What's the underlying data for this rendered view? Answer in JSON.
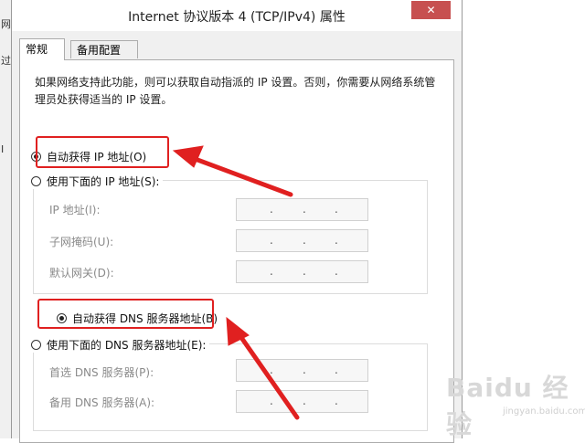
{
  "background_window": {
    "fragments": [
      "网",
      "过",
      "I"
    ]
  },
  "window": {
    "title": "Internet 协议版本 4 (TCP/IPv4) 属性",
    "close_glyph": "✕"
  },
  "tabs": [
    {
      "label": "常规",
      "active": true
    },
    {
      "label": "备用配置",
      "active": false
    }
  ],
  "general": {
    "description": "如果网络支持此功能，则可以获取自动指派的 IP 设置。否则，你需要从网络系统管理员处获得适当的 IP 设置。",
    "ip_mode": {
      "auto_label": "自动获得 IP 地址(O)",
      "manual_label": "使用下面的 IP 地址(S):",
      "selected": "auto"
    },
    "ip_fields": [
      {
        "label": "IP 地址(I):",
        "value": ""
      },
      {
        "label": "子网掩码(U):",
        "value": ""
      },
      {
        "label": "默认网关(D):",
        "value": ""
      }
    ],
    "dns_mode": {
      "auto_label": "自动获得 DNS 服务器地址(B)",
      "manual_label": "使用下面的 DNS 服务器地址(E):",
      "selected": "auto"
    },
    "dns_fields": [
      {
        "label": "首选 DNS 服务器(P):",
        "value": ""
      },
      {
        "label": "备用 DNS 服务器(A):",
        "value": ""
      }
    ]
  },
  "annotations": {
    "highlight_color": "#e02020",
    "arrow_color": "#e02020"
  },
  "watermark": {
    "logo_text": "Baidu 经验",
    "url": "jingyan.baidu.com"
  },
  "colors": {
    "close_button": "#c75050",
    "dialog_bg": "#f0f0f0",
    "disabled_text": "#8a8a8a"
  }
}
